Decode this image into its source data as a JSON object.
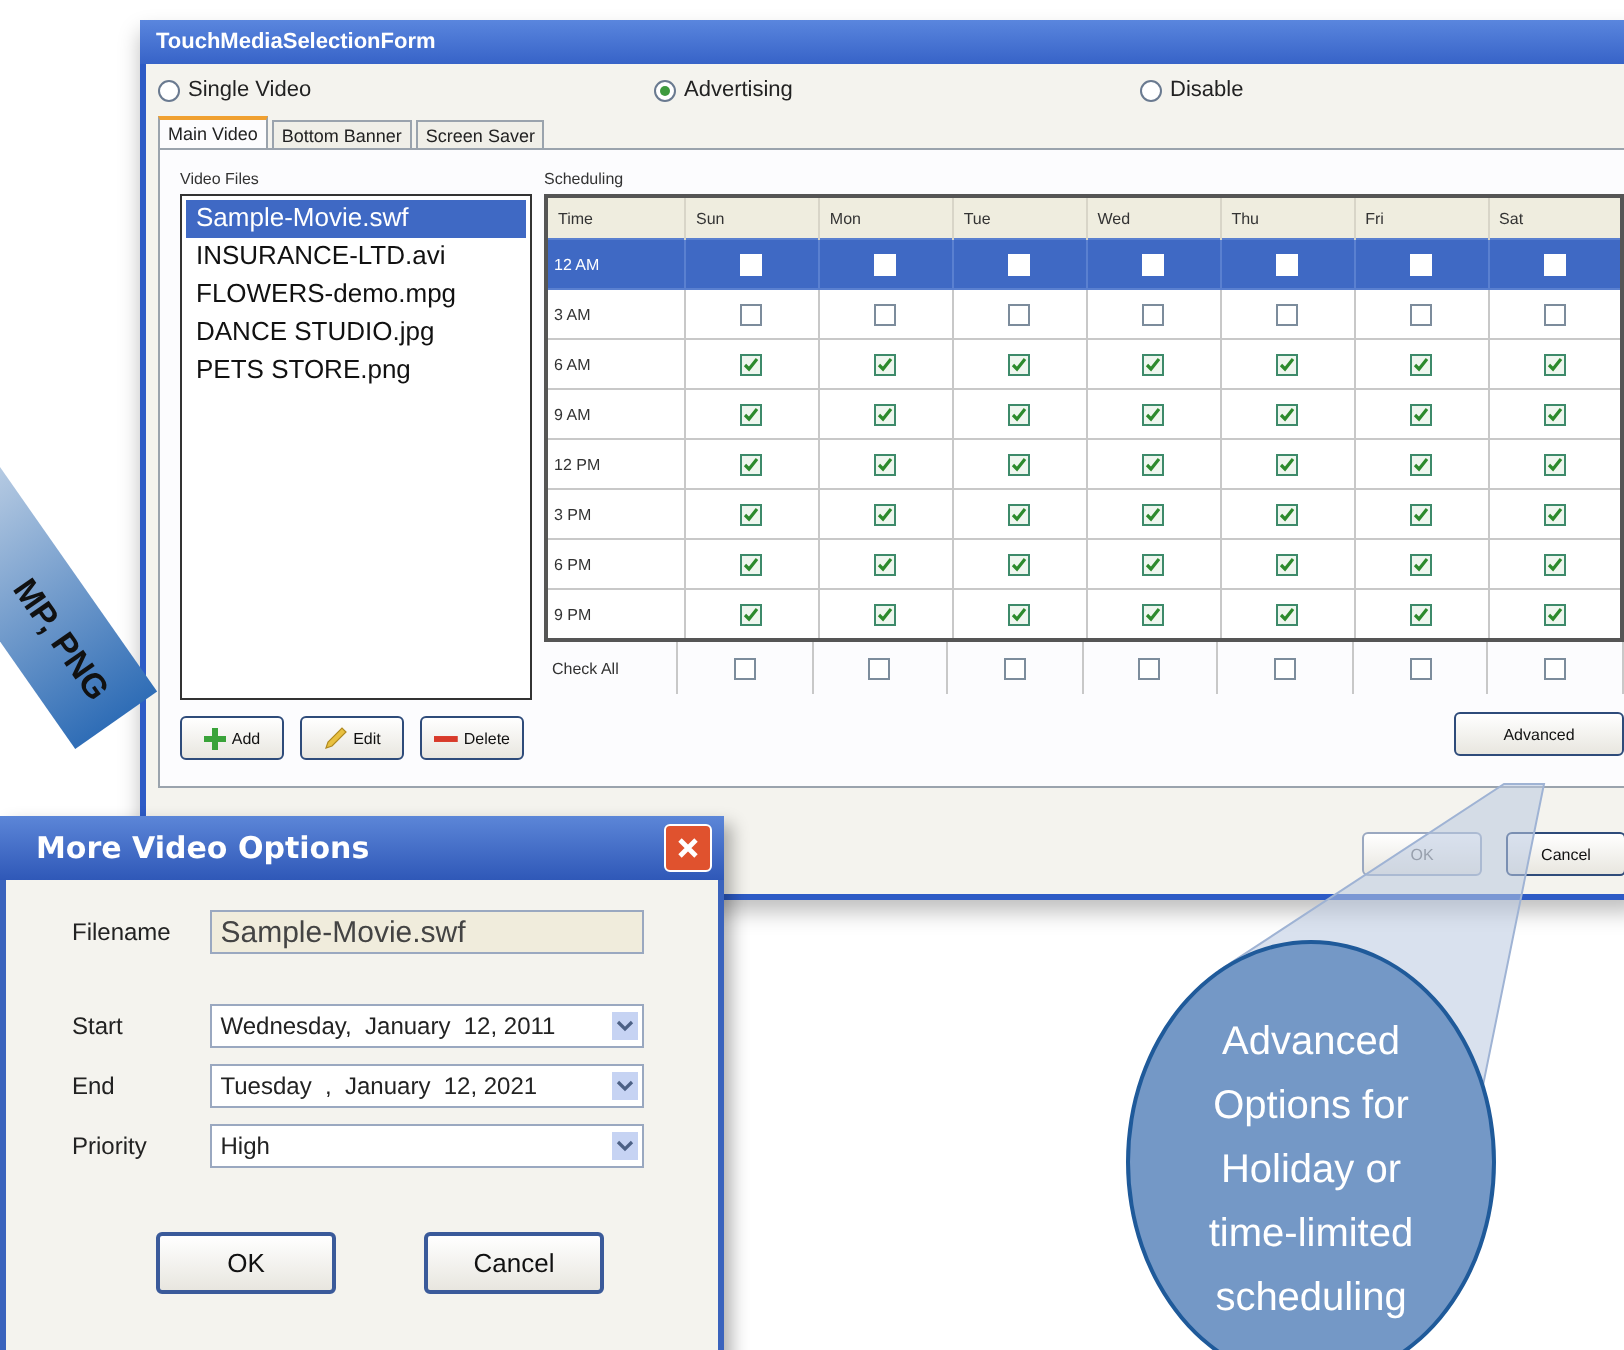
{
  "main_window": {
    "title": "TouchMediaSelectionForm",
    "modes": [
      {
        "label": "Single Video",
        "selected": false
      },
      {
        "label": "Advertising",
        "selected": true
      },
      {
        "label": "Disable",
        "selected": false
      }
    ],
    "tabs": [
      {
        "label": "Main Video",
        "selected": true
      },
      {
        "label": "Bottom Banner",
        "selected": false
      },
      {
        "label": "Screen Saver",
        "selected": false
      }
    ],
    "video_files": {
      "label": "Video Files",
      "items": [
        {
          "name": "Sample-Movie.swf",
          "selected": true
        },
        {
          "name": "INSURANCE-LTD.avi",
          "selected": false
        },
        {
          "name": "FLOWERS-demo.mpg",
          "selected": false
        },
        {
          "name": "DANCE STUDIO.jpg",
          "selected": false
        },
        {
          "name": "PETS STORE.png",
          "selected": false
        }
      ]
    },
    "scheduling": {
      "label": "Scheduling",
      "columns": [
        "Time",
        "Sun",
        "Mon",
        "Tue",
        "Wed",
        "Thu",
        "Fri",
        "Sat"
      ],
      "rows": [
        {
          "time": "12 AM",
          "selected": true,
          "days": [
            false,
            false,
            false,
            false,
            false,
            false,
            false
          ]
        },
        {
          "time": "3 AM",
          "selected": false,
          "days": [
            false,
            false,
            false,
            false,
            false,
            false,
            false
          ]
        },
        {
          "time": "6 AM",
          "selected": false,
          "days": [
            true,
            true,
            true,
            true,
            true,
            true,
            true
          ]
        },
        {
          "time": "9 AM",
          "selected": false,
          "days": [
            true,
            true,
            true,
            true,
            true,
            true,
            true
          ]
        },
        {
          "time": "12 PM",
          "selected": false,
          "days": [
            true,
            true,
            true,
            true,
            true,
            true,
            true
          ]
        },
        {
          "time": "3 PM",
          "selected": false,
          "days": [
            true,
            true,
            true,
            true,
            true,
            true,
            true
          ]
        },
        {
          "time": "6 PM",
          "selected": false,
          "days": [
            true,
            true,
            true,
            true,
            true,
            true,
            true
          ]
        },
        {
          "time": "9 PM",
          "selected": false,
          "days": [
            true,
            true,
            true,
            true,
            true,
            true,
            true
          ]
        }
      ],
      "check_all": {
        "label": "Check All",
        "days": [
          false,
          false,
          false,
          false,
          false,
          false,
          false
        ]
      }
    },
    "list_buttons": [
      {
        "label": "Add",
        "kind": "add"
      },
      {
        "label": "Edit",
        "kind": "edit"
      },
      {
        "label": "Delete",
        "kind": "delete"
      }
    ],
    "advanced_button": "Advanced",
    "footer_buttons": [
      {
        "label": "OK",
        "disabled": true
      },
      {
        "label": "Cancel",
        "disabled": false
      }
    ]
  },
  "dialog": {
    "title": "More Video Options",
    "fields": [
      {
        "label": "Filename",
        "value": "Sample-Movie.swf",
        "kind": "readonly"
      },
      {
        "label": "Start",
        "value": "Wednesday,  January  12, 2011",
        "kind": "dropdown"
      },
      {
        "label": "End",
        "value": "Tuesday  ,  January  12, 2021",
        "kind": "dropdown"
      },
      {
        "label": "Priority",
        "value": "High",
        "kind": "dropdown"
      }
    ],
    "buttons": [
      "OK",
      "Cancel"
    ]
  },
  "callout": "Advanced Options for Holiday or time-limited scheduling",
  "banner": "MP, PNG"
}
